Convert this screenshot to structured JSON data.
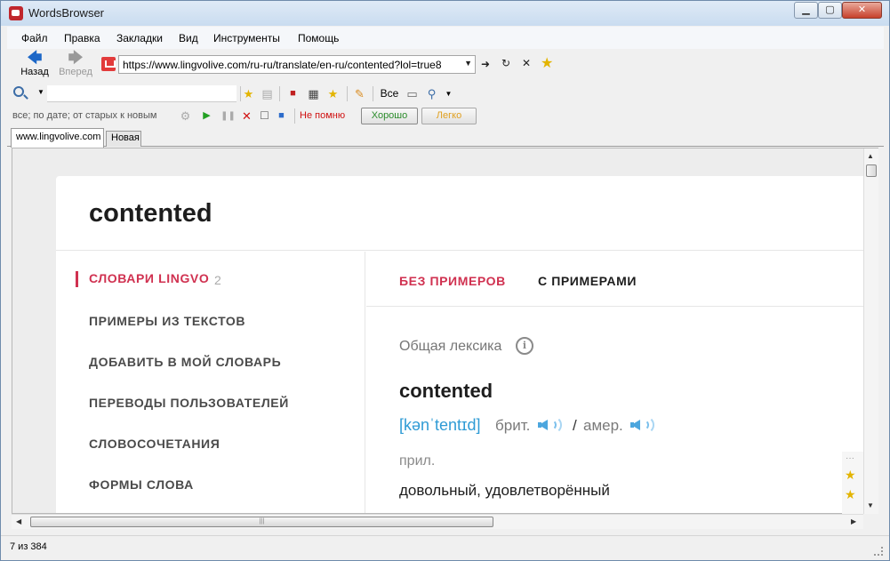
{
  "window": {
    "title": "WordsBrowser"
  },
  "menu": [
    "Файл",
    "Правка",
    "Закладки",
    "Вид",
    "Инструменты",
    "Помощь"
  ],
  "nav": {
    "back_label": "Назад",
    "forward_label": "Вперед",
    "url": "https://www.lingvolive.com/ru-ru/translate/en-ru/contented?lol=true8"
  },
  "toolbar": {
    "search_value": "",
    "all_label": "Все"
  },
  "filter": {
    "sort_label": "все; по дате; от старых к новым",
    "not_remember_label": "Не помню",
    "good_label": "Хорошо",
    "easy_label": "Легко"
  },
  "tabs": [
    {
      "label": "www.lingvolive.com",
      "active": true
    },
    {
      "label": "Новая",
      "active": false
    }
  ],
  "page": {
    "title": "contented",
    "sidebar": [
      {
        "label": "Словари Lingvo",
        "count": "2",
        "active": true
      },
      {
        "label": "Примеры из текстов"
      },
      {
        "label": "Добавить в мой словарь"
      },
      {
        "label": "Переводы пользователей"
      },
      {
        "label": "Словосочетания"
      },
      {
        "label": "Формы слова"
      }
    ],
    "modes": {
      "without_examples": "БЕЗ ПРИМЕРОВ",
      "with_examples": "С ПРИМЕРАМИ"
    },
    "entry": {
      "category": "Общая лексика",
      "word": "contented",
      "transcription": "[kənˈtentɪd]",
      "brit_label": "брит.",
      "slash": "/",
      "amer_label": "амер.",
      "pos": "прил.",
      "translation": "довольный, удовлетворённый"
    }
  },
  "status": {
    "text": "7 из 384"
  },
  "colors": {
    "accent": "#d03150",
    "link": "#2f9bd5"
  }
}
